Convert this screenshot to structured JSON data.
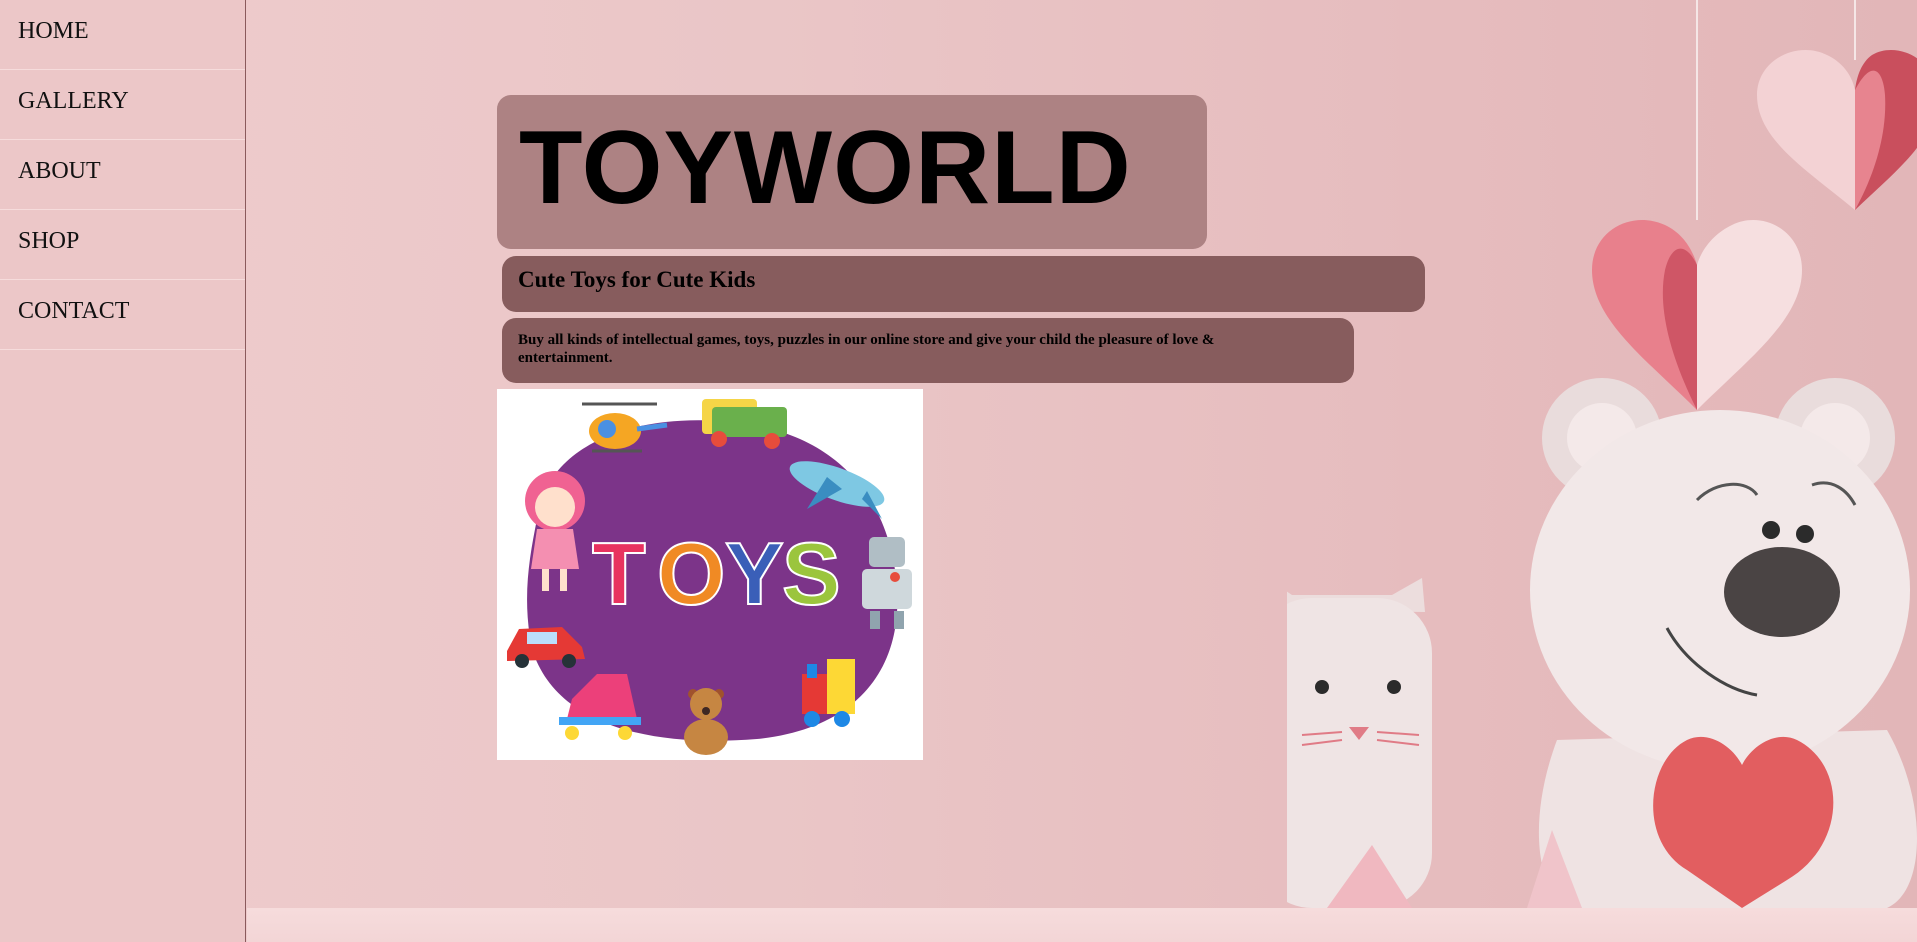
{
  "nav": {
    "items": [
      {
        "label": "HOME"
      },
      {
        "label": "GALLERY"
      },
      {
        "label": "ABOUT"
      },
      {
        "label": "SHOP"
      },
      {
        "label": "CONTACT"
      }
    ]
  },
  "hero": {
    "title": "TOYWORLD",
    "subtitle": "Cute Toys for Cute Kids",
    "description": "Buy all kinds of intellectual games, toys, puzzles in our online store and give your child the pleasure of love & entertainment."
  },
  "toys_logo": {
    "letters": [
      "T",
      "O",
      "Y",
      "S"
    ],
    "letter_colors": [
      "#e8335f",
      "#f08a24",
      "#3a5fb8",
      "#9bc53d"
    ],
    "circle_color": "#7c3489"
  },
  "colors": {
    "title_box": "#ad8283",
    "subtitle_box": "#875c5d",
    "sidebar": "#ecc7c8"
  }
}
